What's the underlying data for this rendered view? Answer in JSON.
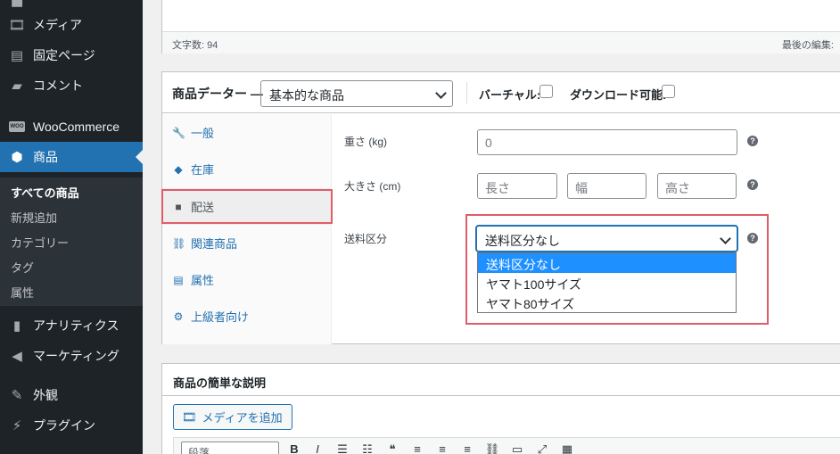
{
  "sidebar": {
    "items": [
      {
        "label": "メディア",
        "icon": "media-icon"
      },
      {
        "label": "固定ページ",
        "icon": "page-icon"
      },
      {
        "label": "コメント",
        "icon": "comment-icon"
      },
      {
        "label": "WooCommerce",
        "icon": "woocommerce-icon",
        "badge": "WOO"
      },
      {
        "label": "商品",
        "icon": "product-box-icon"
      },
      {
        "label": "アナリティクス",
        "icon": "analytics-icon"
      },
      {
        "label": "マーケティング",
        "icon": "megaphone-icon"
      },
      {
        "label": "外観",
        "icon": "brush-icon"
      },
      {
        "label": "プラグイン",
        "icon": "plugin-icon"
      }
    ],
    "submenu": [
      "すべての商品",
      "新規追加",
      "カテゴリー",
      "タグ",
      "属性"
    ]
  },
  "editor": {
    "word_count": "文字数: 94",
    "last_edited": "最後の編集:"
  },
  "product_data": {
    "title": "商品データー —",
    "product_type": "基本的な商品",
    "virtual_label": "バーチャル:",
    "downloadable_label": "ダウンロード可能:",
    "tabs": [
      {
        "label": "一般",
        "icon": "wrench-icon"
      },
      {
        "label": "在庫",
        "icon": "tag-icon"
      },
      {
        "label": "配送",
        "icon": "truck-icon"
      },
      {
        "label": "関連商品",
        "icon": "link-icon"
      },
      {
        "label": "属性",
        "icon": "list-icon"
      },
      {
        "label": "上級者向け",
        "icon": "gear-icon"
      }
    ],
    "active_tab": "配送",
    "shipping": {
      "weight_label": "重さ (kg)",
      "weight_placeholder": "0",
      "dimensions_label": "大きさ (cm)",
      "length_placeholder": "長さ",
      "width_placeholder": "幅",
      "height_placeholder": "高さ",
      "class_label": "送料区分",
      "class_value": "送料区分なし",
      "class_options": [
        "送料区分なし",
        "ヤマト100サイズ",
        "ヤマト80サイズ"
      ]
    }
  },
  "excerpt": {
    "title": "商品の簡単な説明",
    "media_button": "メディアを追加",
    "paragraph": "段落"
  },
  "colors": {
    "admin_bg": "#1d2327",
    "accent": "#2271b1",
    "highlight": "#e05d68",
    "option_selected": "#1e90ff"
  }
}
